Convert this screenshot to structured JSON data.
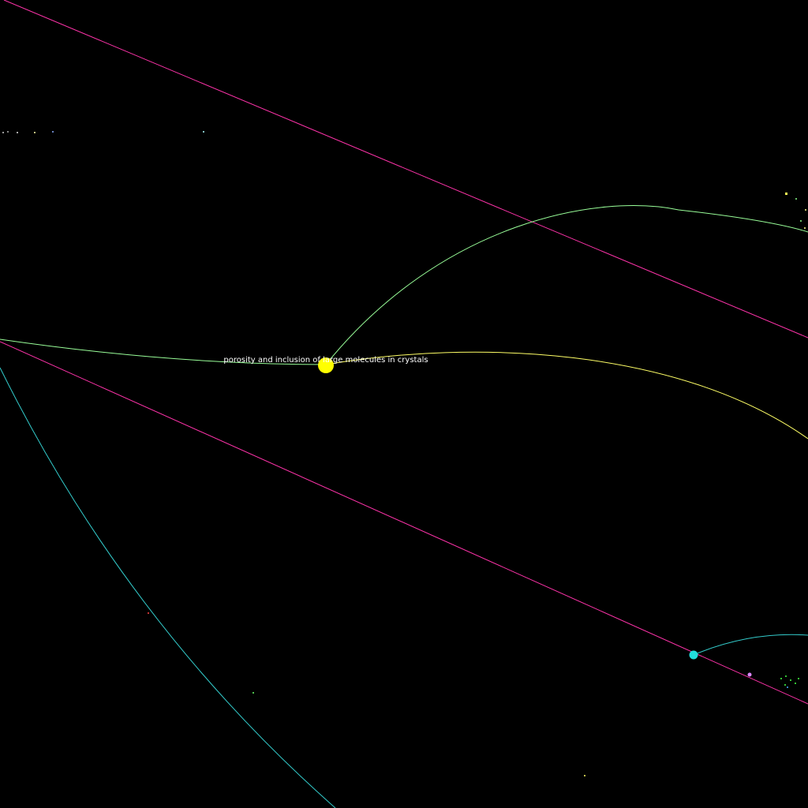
{
  "colors": {
    "background": "#000000",
    "magenta_edge": "#ff33aa",
    "green_edge": "#99ff99",
    "yellow_edge": "#ffff66",
    "cyan_edge": "#33cccc",
    "label_text": "#ffffff"
  },
  "focus_node": {
    "label": "porosity and inclusion of large molecules in crystals",
    "color": "#ffff00"
  },
  "secondary_nodes": [
    {
      "color": "#22dddd"
    },
    {
      "color": "#dd88ff"
    }
  ]
}
